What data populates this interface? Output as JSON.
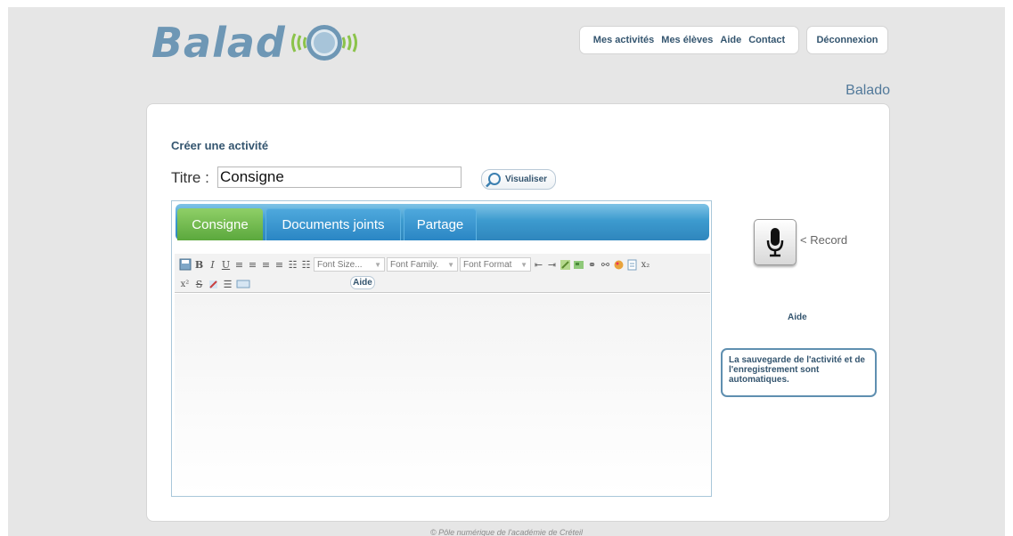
{
  "logo": {
    "text": "Balad"
  },
  "nav": {
    "items": [
      {
        "label": "Mes activités"
      },
      {
        "label": "Mes élèves"
      },
      {
        "label": "Aide"
      },
      {
        "label": "Contact"
      }
    ],
    "logout_label": "Déconnexion"
  },
  "site_name": "Balado",
  "form": {
    "heading": "Créer une activité",
    "title_label": "Titre :",
    "title_value": "Consigne",
    "preview_label": "Visualiser"
  },
  "tabs": [
    {
      "label": "Consigne"
    },
    {
      "label": "Documents joints"
    },
    {
      "label": "Partage"
    }
  ],
  "toolbar": {
    "font_size": "Font Size...",
    "font_family": "Font Family.",
    "font_format": "Font Format",
    "aide_label": "Aide"
  },
  "sidebar": {
    "record_label": "< Record",
    "aide_label": "Aide",
    "info_text": "La sauvegarde de l'activité et de l'enregistrement sont automatiques."
  },
  "footer": {
    "text": "© Pôle numérique de l'académie de Créteil"
  },
  "colors": {
    "accent": "#34556f",
    "tab_active": "#6db64a",
    "tab_bar": "#3d9bcf"
  }
}
